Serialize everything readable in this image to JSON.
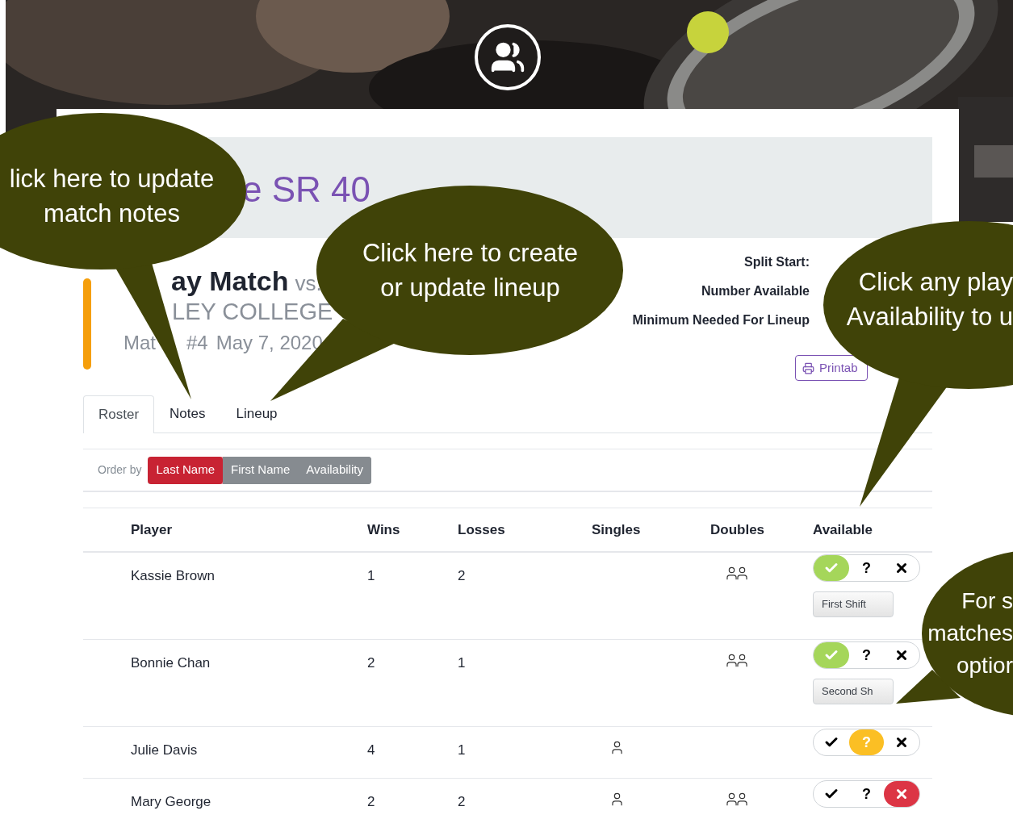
{
  "header": {
    "title": "e SR 40"
  },
  "match": {
    "type": "ay Match",
    "vs": "vs.",
    "opponent": "LEY COLLEGE",
    "number_prefix": "Mat",
    "number": "#4",
    "date": "May 7, 2020"
  },
  "info_labels": [
    "Split Start:",
    "Number Available",
    "Minimum Needed For Lineup"
  ],
  "print_button": "Printab",
  "tabs": [
    {
      "label": "Roster",
      "selected": true
    },
    {
      "label": "Notes",
      "selected": false
    },
    {
      "label": "Lineup",
      "selected": false
    }
  ],
  "order_by": {
    "label": "Order by",
    "options": [
      {
        "label": "Last Name",
        "selected": true
      },
      {
        "label": "First Name",
        "selected": false
      },
      {
        "label": "Availability",
        "selected": false
      }
    ]
  },
  "table": {
    "columns": [
      "Player",
      "Wins",
      "Losses",
      "Singles",
      "Doubles",
      "Available"
    ],
    "rows": [
      {
        "player": "Kassie Brown",
        "wins": "1",
        "losses": "2",
        "singles": false,
        "doubles": true,
        "availability": [
          {
            "kind": "yes",
            "selected": true
          },
          {
            "kind": "maybe",
            "label": "?",
            "selected": false
          },
          {
            "kind": "no",
            "selected": false
          }
        ],
        "shift": "First Shift"
      },
      {
        "player": "Bonnie Chan",
        "wins": "2",
        "losses": "1",
        "singles": false,
        "doubles": true,
        "availability": [
          {
            "kind": "yes",
            "selected": true
          },
          {
            "kind": "maybe",
            "label": "?",
            "selected": false
          },
          {
            "kind": "no",
            "selected": false
          }
        ],
        "shift": "Second Sh"
      },
      {
        "player": "Julie Davis",
        "wins": "4",
        "losses": "1",
        "singles": true,
        "doubles": false,
        "availability": [
          {
            "kind": "yes",
            "selected": false
          },
          {
            "kind": "maybe",
            "label": "?",
            "selected": true
          },
          {
            "kind": "no",
            "selected": false
          }
        ]
      },
      {
        "player": "Mary George",
        "wins": "2",
        "losses": "2",
        "singles": true,
        "doubles": true,
        "availability": [
          {
            "kind": "yes",
            "selected": false
          },
          {
            "kind": "maybe",
            "label": "?",
            "selected": false
          },
          {
            "kind": "no",
            "selected": true
          }
        ]
      }
    ]
  },
  "callouts": [
    {
      "lines": [
        "lick here to update",
        "match notes"
      ]
    },
    {
      "lines": [
        "Click here to create",
        "or update lineup"
      ]
    },
    {
      "lines": [
        "Click any play",
        "Availability to u"
      ]
    },
    {
      "lines": [
        "For s",
        "matches",
        "optior"
      ]
    }
  ]
}
